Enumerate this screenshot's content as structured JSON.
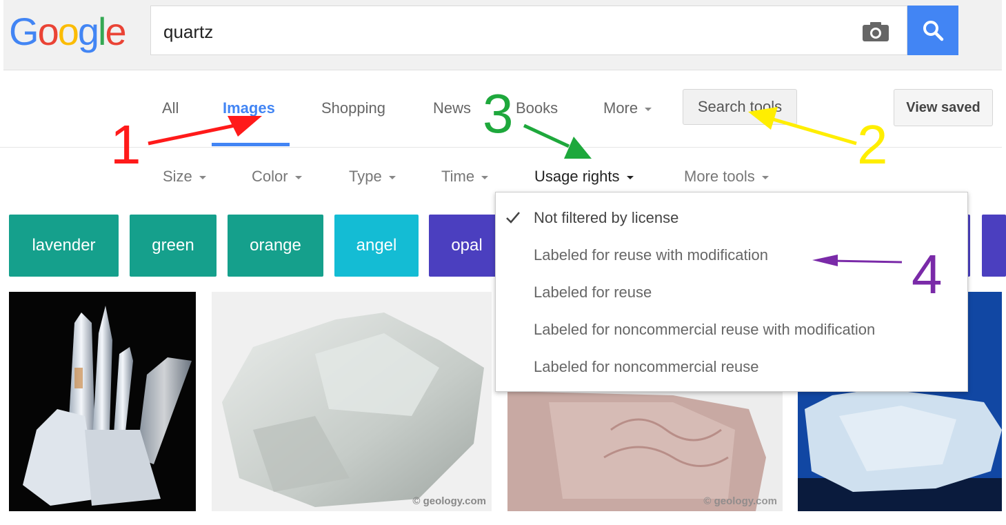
{
  "logo": {
    "letters": [
      "G",
      "o",
      "o",
      "g",
      "l",
      "e"
    ],
    "colors": [
      "#4285f4",
      "#ea4335",
      "#fbbc05",
      "#4285f4",
      "#34a853",
      "#ea4335"
    ]
  },
  "search": {
    "query": "quartz",
    "camera_icon": "camera-icon",
    "search_icon": "magnifier-icon"
  },
  "tabs": [
    {
      "label": "All"
    },
    {
      "label": "Images"
    },
    {
      "label": "Shopping"
    },
    {
      "label": "News"
    },
    {
      "label": "Books"
    },
    {
      "label": "More"
    }
  ],
  "buttons": {
    "search_tools": "Search tools",
    "view_saved": "View saved"
  },
  "tools": [
    {
      "label": "Size"
    },
    {
      "label": "Color"
    },
    {
      "label": "Type"
    },
    {
      "label": "Time"
    },
    {
      "label": "Usage rights"
    },
    {
      "label": "More tools"
    }
  ],
  "chips": [
    {
      "label": "lavender",
      "color": "#15a08c"
    },
    {
      "label": "green",
      "color": "#15a08c"
    },
    {
      "label": "orange",
      "color": "#15a08c"
    },
    {
      "label": "angel",
      "color": "#14bcd4"
    },
    {
      "label": "opal",
      "color": "#4b3fbf"
    },
    {
      "label": "",
      "color": "#4b3fbf"
    }
  ],
  "usage_rights_menu": {
    "selected": "Not filtered by license",
    "options": [
      "Not filtered by license",
      "Labeled for reuse with modification",
      "Labeled for reuse",
      "Labeled for noncommercial reuse with modification",
      "Labeled for noncommercial reuse"
    ]
  },
  "images": [
    {
      "watermark": ""
    },
    {
      "watermark": "© geology.com"
    },
    {
      "watermark": "© geology.com"
    },
    {
      "watermark": ""
    }
  ],
  "annotations": [
    {
      "label": "1",
      "color": "#ff1a1a"
    },
    {
      "label": "2",
      "color": "#ffee00"
    },
    {
      "label": "3",
      "color": "#1ea83c"
    },
    {
      "label": "4",
      "color": "#7a2aa8"
    }
  ]
}
